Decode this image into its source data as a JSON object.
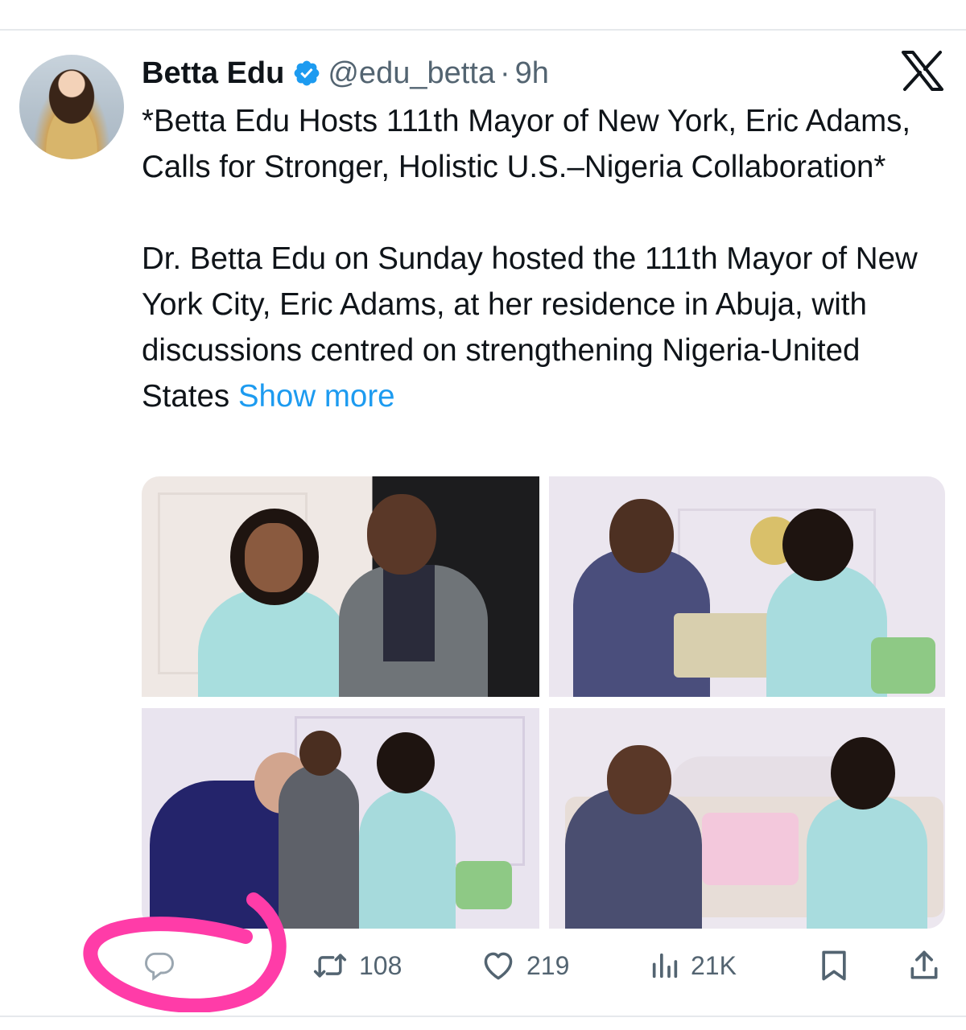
{
  "tweet": {
    "author_name": "Betta Edu",
    "handle": "@edu_betta",
    "separator": "·",
    "time": "9h",
    "headline": "*Betta Edu Hosts 111th Mayor of New York, Eric Adams, Calls for Stronger, Holistic U.S.–Nigeria Collaboration*",
    "body": "Dr. Betta Edu on Sunday hosted the 111th Mayor of New York City, Eric Adams, at her residence in Abuja, with discussions centred on strengthening Nigeria-United States ",
    "show_more": "Show more"
  },
  "actions": {
    "reply_count": "",
    "retweet_count": "108",
    "like_count": "219",
    "view_count": "21K"
  },
  "icons": {
    "verified": "verified-badge-icon",
    "logo": "x-logo-icon",
    "reply": "reply-icon",
    "retweet": "retweet-icon",
    "like": "heart-icon",
    "views": "views-chart-icon",
    "bookmark": "bookmark-icon",
    "share": "share-icon"
  },
  "colors": {
    "link": "#1d9bf0",
    "verified": "#1d9bf0",
    "text": "#0f1419",
    "secondary": "#536471",
    "annotation": "#ff3ca8"
  }
}
